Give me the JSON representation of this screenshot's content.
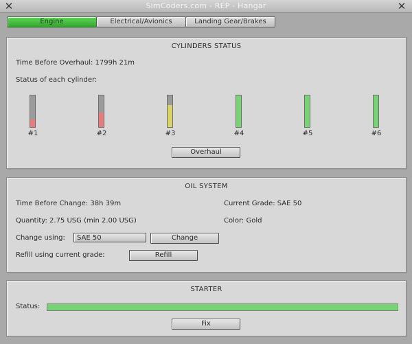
{
  "window": {
    "title": "SimCoders.com - REP - Hangar",
    "close_left": "✕",
    "close_right": "✕"
  },
  "tabs": [
    {
      "label": "Engine",
      "active": true
    },
    {
      "label": "Electrical/Avionics",
      "active": false
    },
    {
      "label": "Landing Gear/Brakes",
      "active": false
    }
  ],
  "cylinders": {
    "title": "CYLINDERS STATUS",
    "time_before_overhaul": "Time Before Overhaul: 1799h 21m",
    "status_label": "Status of each cylinder:",
    "items": [
      {
        "label": "#1",
        "level": 0.25,
        "color": "#e87b7b"
      },
      {
        "label": "#2",
        "level": 0.45,
        "color": "#e87b7b"
      },
      {
        "label": "#3",
        "level": 0.7,
        "color": "#d8d468"
      },
      {
        "label": "#4",
        "level": 1.0,
        "color": "#77d374"
      },
      {
        "label": "#5",
        "level": 1.0,
        "color": "#77d374"
      },
      {
        "label": "#6",
        "level": 1.0,
        "color": "#77d374"
      }
    ],
    "overhaul_button": "Overhaul"
  },
  "oil": {
    "title": "OIL SYSTEM",
    "time_before_change": "Time Before Change: 38h 39m",
    "current_grade": "Current Grade: SAE 50",
    "quantity": "Quantity: 2.75 USG (min 2.00 USG)",
    "color": "Color: Gold",
    "change_using_label": "Change using:",
    "change_select_value": "SAE  50",
    "change_button": "Change",
    "refill_label": "Refill using current grade:",
    "refill_button": "Refill"
  },
  "starter": {
    "title": "STARTER",
    "status_label": "Status:",
    "status_level": 1.0,
    "fix_button": "Fix"
  }
}
